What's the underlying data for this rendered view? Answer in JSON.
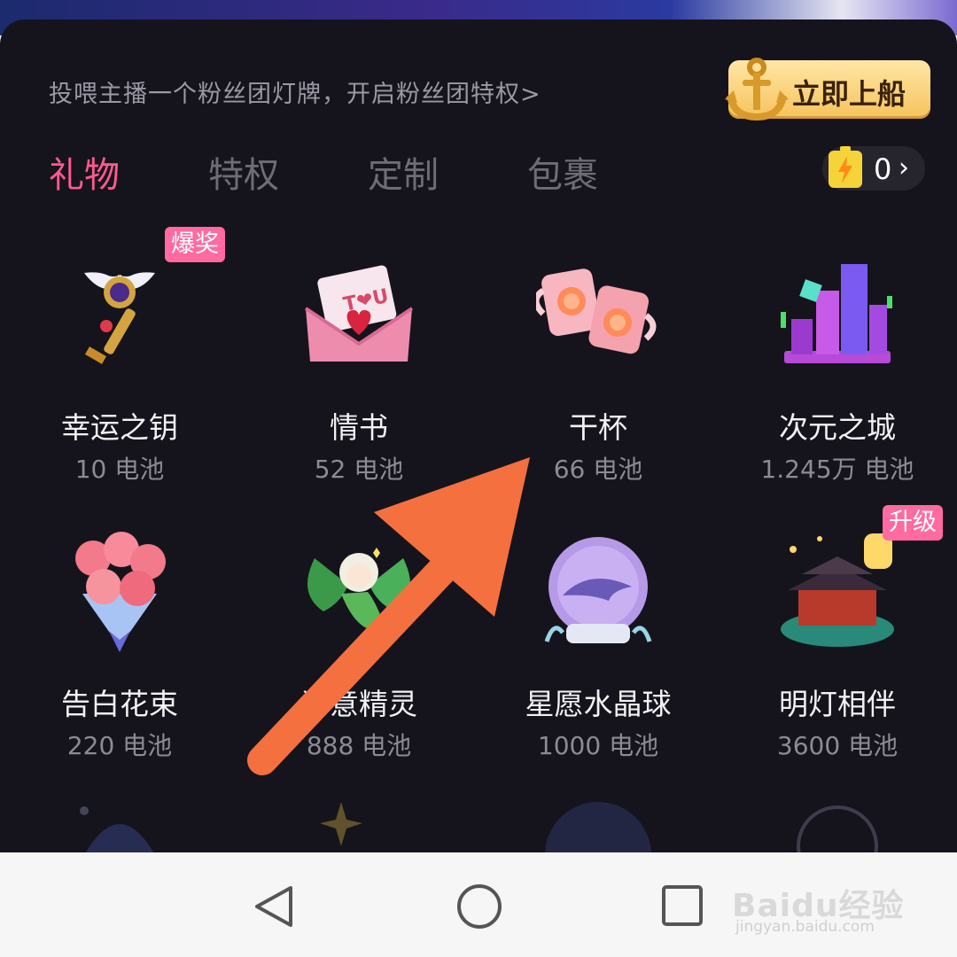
{
  "header": {
    "fan_club_text": "投喂主播一个粉丝团灯牌，开启粉丝团特权>",
    "board_button_label": "立即上船"
  },
  "tabs": [
    {
      "label": "礼物",
      "active": true
    },
    {
      "label": "特权",
      "active": false
    },
    {
      "label": "定制",
      "active": false
    },
    {
      "label": "包裹",
      "active": false
    }
  ],
  "balance": {
    "count": "0",
    "icon": "battery-icon"
  },
  "gifts": [
    {
      "name": "幸运之钥",
      "price": "10 电池",
      "badge": "爆奖",
      "icon": "key-icon"
    },
    {
      "name": "情书",
      "price": "52 电池",
      "badge": null,
      "icon": "love-letter-icon"
    },
    {
      "name": "干杯",
      "price": "66 电池",
      "badge": null,
      "icon": "cheers-cups-icon"
    },
    {
      "name": "次元之城",
      "price": "1.245万 电池",
      "badge": null,
      "icon": "city-icon"
    },
    {
      "name": "告白花束",
      "price": "220 电池",
      "badge": null,
      "icon": "bouquet-icon"
    },
    {
      "name": "诗意精灵",
      "price": "888 电池",
      "badge": null,
      "icon": "fairy-icon"
    },
    {
      "name": "星愿水晶球",
      "price": "1000 电池",
      "badge": null,
      "icon": "crystal-ball-icon"
    },
    {
      "name": "明灯相伴",
      "price": "3600 电池",
      "badge": "升级",
      "icon": "lantern-palace-icon"
    }
  ],
  "annotation": {
    "arrow_color": "#f4703f"
  },
  "navbar": {
    "back": "back-icon",
    "home": "home-icon",
    "recent": "recents-icon"
  },
  "watermark": {
    "logo": "Baidu经验",
    "url": "jingyan.baidu.com"
  },
  "colors": {
    "accent_pink": "#ff5a8e",
    "panel_bg": "#15141c",
    "gold": "#f6c35c"
  }
}
